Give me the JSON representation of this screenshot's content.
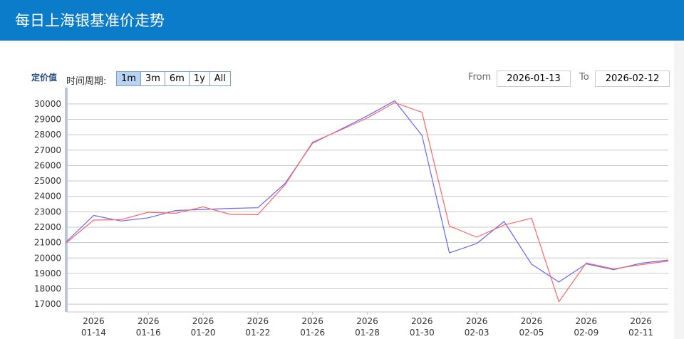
{
  "page": {
    "title": "每日上海银基准价走势"
  },
  "toolbar": {
    "y_title": "定价值",
    "range_label": "时间周期:",
    "range_buttons": [
      "1m",
      "3m",
      "6m",
      "1y",
      "All"
    ],
    "active_range": "1m",
    "from_label": "From",
    "from_value": "2026-01-13",
    "to_label": "To",
    "to_value": "2026-02-12"
  },
  "colors": {
    "header": "#0a7cc9",
    "series_blue": "#6666ff",
    "series_red": "#ff6666",
    "axis": "#b9c7dd",
    "grid": "#c8c8c8"
  },
  "chart_data": {
    "type": "line",
    "ylabel": "定价值",
    "ylim": [
      16500,
      30500
    ],
    "yticks": [
      17000,
      18000,
      19000,
      20000,
      21000,
      22000,
      23000,
      24000,
      25000,
      26000,
      27000,
      28000,
      29000,
      30000
    ],
    "grid": true,
    "x": [
      "2026-01-13",
      "2026-01-14",
      "2026-01-15",
      "2026-01-16",
      "2026-01-19",
      "2026-01-20",
      "2026-01-21",
      "2026-01-22",
      "2026-01-23",
      "2026-01-26",
      "2026-01-27",
      "2026-01-28",
      "2026-01-29",
      "2026-01-30",
      "2026-02-02",
      "2026-02-03",
      "2026-02-04",
      "2026-02-05",
      "2026-02-06",
      "2026-02-09",
      "2026-02-10",
      "2026-02-11",
      "2026-02-12"
    ],
    "xticks": [
      {
        "index": 1,
        "line1": "2026",
        "line2": "01-14"
      },
      {
        "index": 3,
        "line1": "2026",
        "line2": "01-16"
      },
      {
        "index": 5,
        "line1": "2026",
        "line2": "01-20"
      },
      {
        "index": 7,
        "line1": "2026",
        "line2": "01-22"
      },
      {
        "index": 9,
        "line1": "2026",
        "line2": "01-26"
      },
      {
        "index": 11,
        "line1": "2026",
        "line2": "01-28"
      },
      {
        "index": 13,
        "line1": "2026",
        "line2": "01-30"
      },
      {
        "index": 15,
        "line1": "2026",
        "line2": "02-03"
      },
      {
        "index": 17,
        "line1": "2026",
        "line2": "02-05"
      },
      {
        "index": 19,
        "line1": "2026",
        "line2": "02-09"
      },
      {
        "index": 21,
        "line1": "2026",
        "line2": "02-11"
      }
    ],
    "series": [
      {
        "color": "#6666ff",
        "values": [
          21050,
          22760,
          22400,
          22610,
          23080,
          23150,
          23220,
          23260,
          24850,
          27450,
          28320,
          29220,
          30200,
          27950,
          20330,
          20940,
          22370,
          19600,
          18440,
          19620,
          19240,
          19660,
          19870
        ]
      },
      {
        "color": "#ff6666",
        "values": [
          20980,
          22460,
          22490,
          22970,
          22900,
          23320,
          22830,
          22810,
          24760,
          27510,
          28280,
          29080,
          30080,
          29450,
          22070,
          21350,
          22140,
          22580,
          17160,
          19680,
          19290,
          19570,
          19800
        ]
      }
    ]
  }
}
